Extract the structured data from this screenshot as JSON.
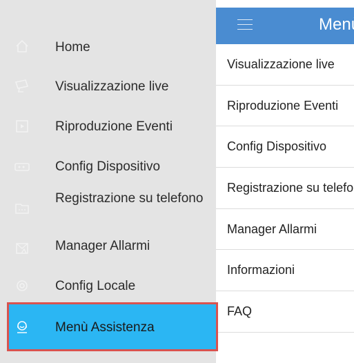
{
  "appbar": {
    "title": "Menù Assistenza"
  },
  "list": [
    "Visualizzazione live",
    "Riproduzione Eventi",
    "Config Dispositivo",
    "Registrazione su telefono",
    "Manager Allarmi",
    "Informazioni",
    "FAQ"
  ],
  "drawer": {
    "items": [
      {
        "label": "Home",
        "icon": "home-icon"
      },
      {
        "label": "Visualizzazione live",
        "icon": "camera-icon"
      },
      {
        "label": "Riproduzione Eventi",
        "icon": "playback-icon"
      },
      {
        "label": "Config Dispositivo",
        "icon": "device-config-icon"
      },
      {
        "label": "Registrazione su telefono",
        "icon": "folder-icon"
      },
      {
        "label": "Manager Allarmi",
        "icon": "alarm-icon"
      },
      {
        "label": "Config Locale",
        "icon": "settings-icon"
      },
      {
        "label": "Menù Assistenza",
        "icon": "support-icon",
        "active": true
      }
    ]
  },
  "colors": {
    "appbar": "#4a8cd1",
    "drawer_bg": "#e4e4e4",
    "active_bg": "#2bb6f3",
    "active_border": "#d9534f"
  }
}
